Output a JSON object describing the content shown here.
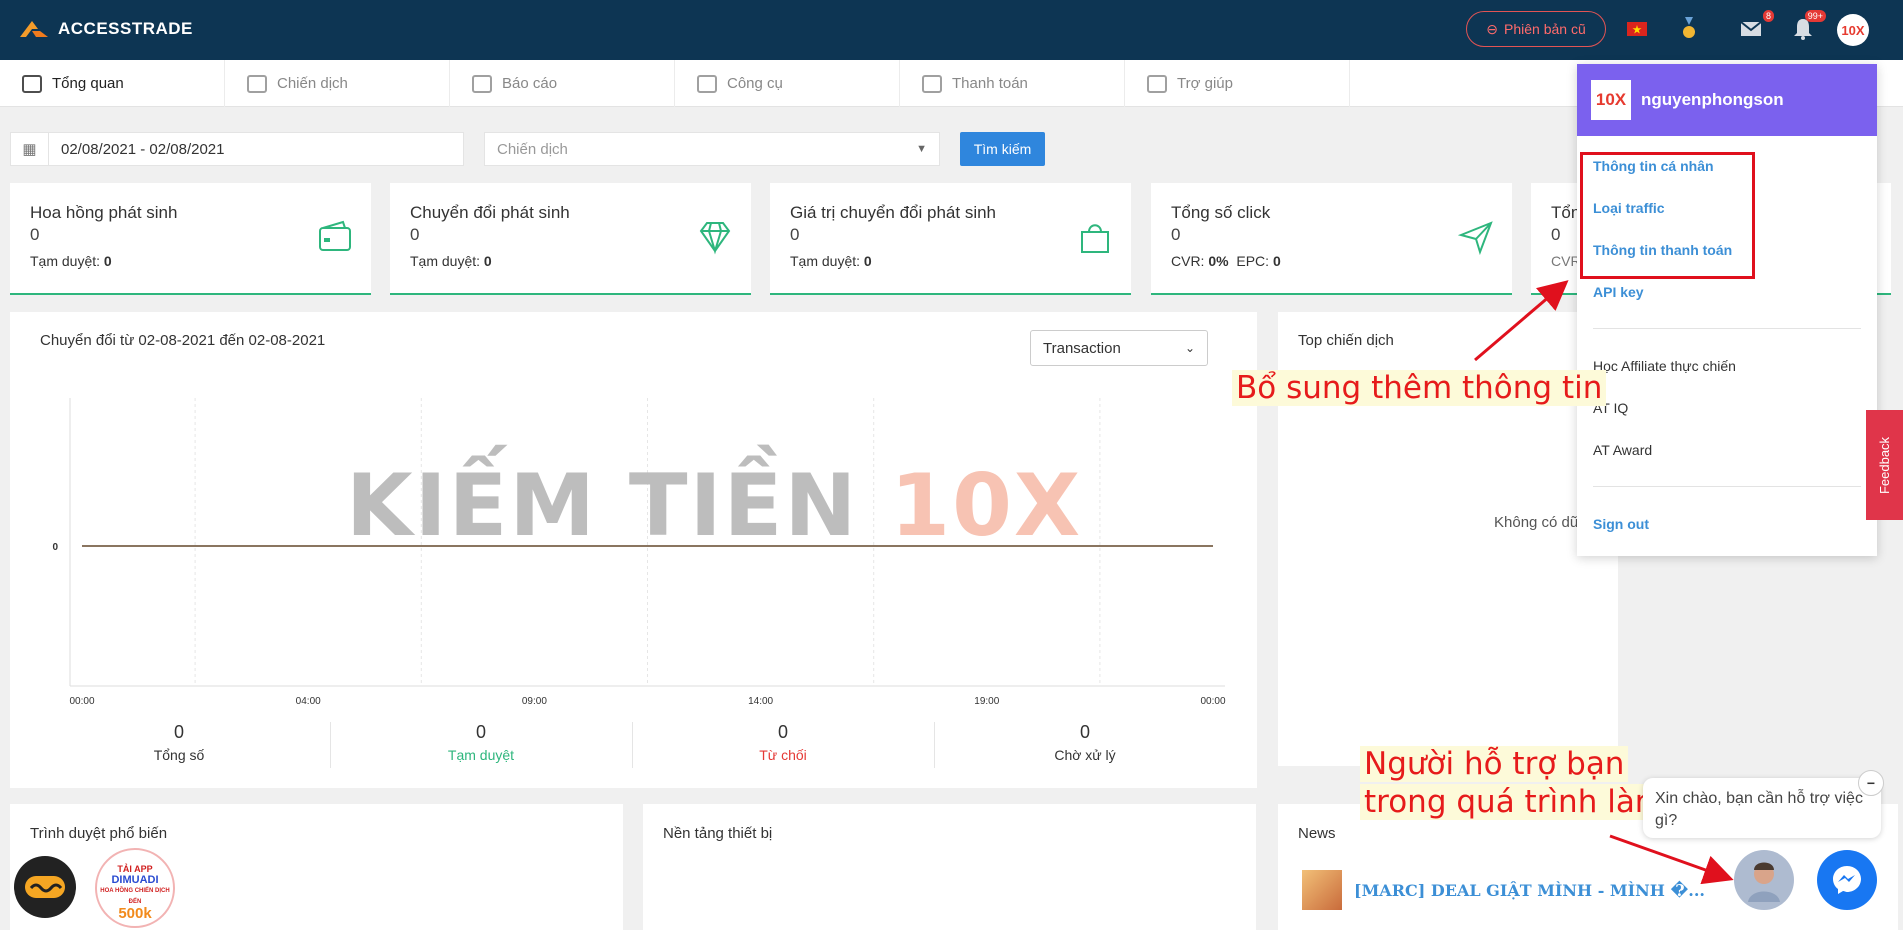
{
  "header": {
    "brand": "ACCESSTRADE",
    "old_version_label": "Phiên bản cũ",
    "mail_badge": "8",
    "bell_badge": "99+",
    "avatar_text": "10X"
  },
  "nav": {
    "items": [
      {
        "label": "Tổng quan"
      },
      {
        "label": "Chiến dịch"
      },
      {
        "label": "Báo cáo"
      },
      {
        "label": "Công cụ"
      },
      {
        "label": "Thanh toán"
      },
      {
        "label": "Trợ giúp"
      }
    ]
  },
  "filters": {
    "date_range": "02/08/2021 - 02/08/2021",
    "campaign_placeholder": "Chiến dịch",
    "search_label": "Tìm kiếm"
  },
  "stats": [
    {
      "title": "Hoa hồng phát sinh",
      "value": "0",
      "sub_label": "Tạm duyệt:",
      "sub_value": "0"
    },
    {
      "title": "Chuyển đổi phát sinh",
      "value": "0",
      "sub_label": "Tạm duyệt:",
      "sub_value": "0"
    },
    {
      "title": "Giá trị chuyển đổi phát sinh",
      "value": "0",
      "sub_label": "Tạm duyệt:",
      "sub_value": "0"
    },
    {
      "title": "Tổng số click",
      "value": "0",
      "cvr_label": "CVR:",
      "cvr_value": "0%",
      "epc_label": "EPC:",
      "epc_value": "0"
    },
    {
      "title": "Tổn",
      "value": "0",
      "sub_label": "CVR"
    }
  ],
  "conversion_panel": {
    "title": "Chuyển đổi từ 02-08-2021 đến 02-08-2021",
    "type_select": "Transaction",
    "summary": [
      {
        "value": "0",
        "label": "Tổng số",
        "color": "#333333"
      },
      {
        "value": "0",
        "label": "Tạm duyệt",
        "color": "#2eb67d"
      },
      {
        "value": "0",
        "label": "Từ chối",
        "color": "#e53935"
      },
      {
        "value": "0",
        "label": "Chờ xử lý",
        "color": "#333333"
      }
    ]
  },
  "chart_data": {
    "type": "line",
    "x": [
      "00:00",
      "04:00",
      "09:00",
      "14:00",
      "19:00",
      "00:00"
    ],
    "series": [
      {
        "values": [
          0,
          0,
          0,
          0,
          0,
          0
        ]
      }
    ],
    "y_ticks": [
      "0"
    ],
    "grid": true
  },
  "watermark": {
    "part1": "KIẾM TIỀN ",
    "part2": "10X"
  },
  "top_campaign": {
    "title": "Top chiến dịch",
    "empty": "Không có dữ"
  },
  "browser_panel": {
    "title": "Trình duyệt phổ biến"
  },
  "device_panel": {
    "title": "Nền tảng thiết bị"
  },
  "news_panel": {
    "title": "News",
    "item": "[MARC] DEAL GIẬT MÌNH - MÌNH �..."
  },
  "promo": {
    "line1": "TẢI APP",
    "line2": "DIMUADI",
    "line3": "HOA HỒNG CHIẾN DỊCH ĐẾN",
    "line4": "500k"
  },
  "user_menu": {
    "username": "nguyenphongson",
    "avatar_text": "10X",
    "items": [
      {
        "label": "Thông tin cá nhân"
      },
      {
        "label": "Loại traffic"
      },
      {
        "label": "Thông tin thanh toán"
      },
      {
        "label": "API key"
      },
      {
        "label": "Học Affiliate thực chiến"
      },
      {
        "label": "AT IQ"
      },
      {
        "label": "AT Award"
      },
      {
        "label": "Sign out"
      }
    ]
  },
  "annotations": {
    "add_info": "Bổ sung thêm thông tin",
    "supporter_line1": "Người hỗ trợ bạn",
    "supporter_line2": "trong quá trình làm"
  },
  "feedback_label": "Feedback",
  "chat": {
    "greeting": "Xin chào, bạn cần hỗ trợ việc gì?"
  },
  "colors": {
    "header": "#0d3553",
    "accent_green": "#2eb67d",
    "menu_purple": "#7b61ee",
    "annotation_red": "#e61b1b",
    "link_blue": "#3c8fd6"
  }
}
